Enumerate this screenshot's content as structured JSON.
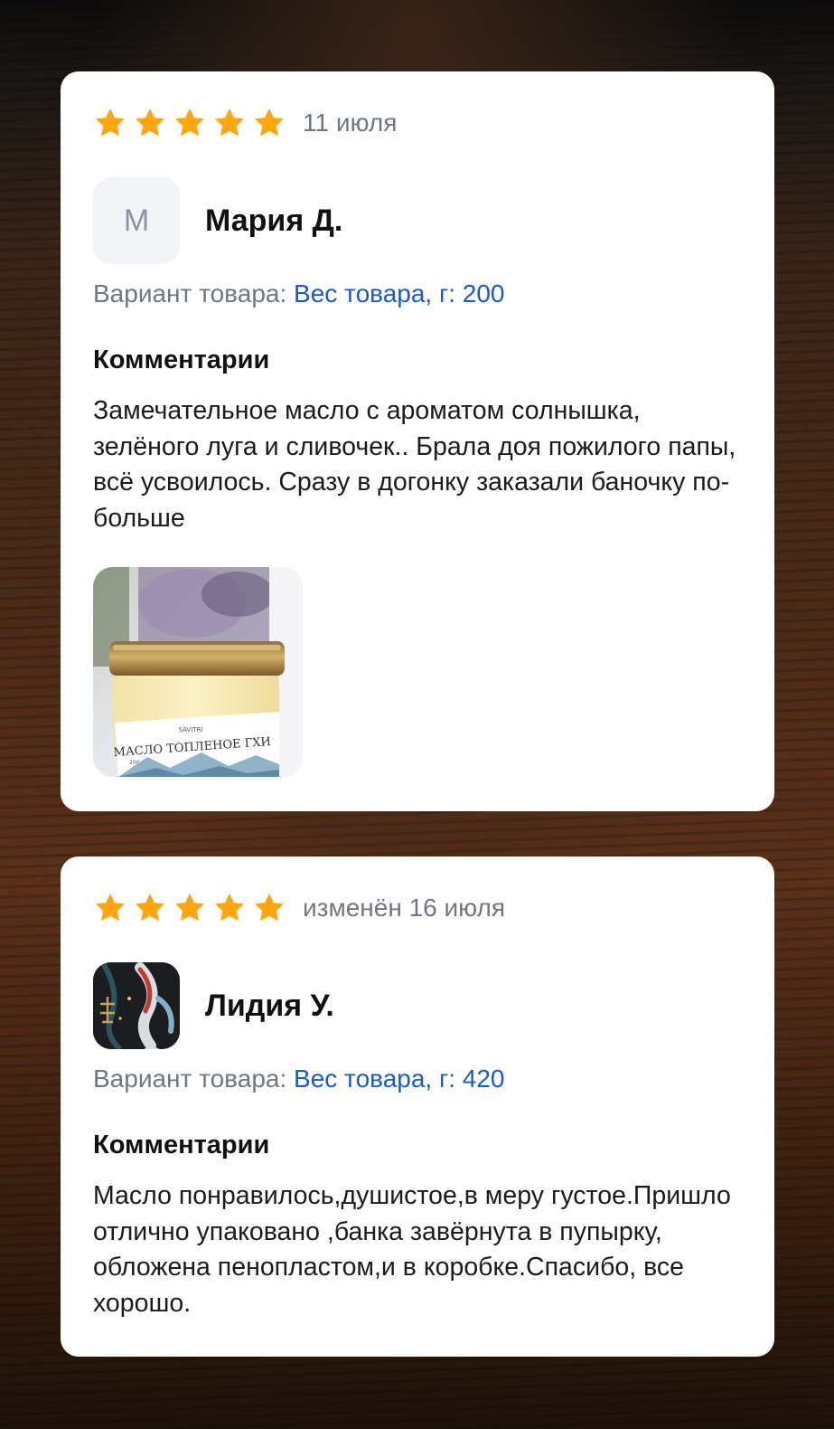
{
  "colors": {
    "star": "#FFA50F",
    "date_text": "#6F7780",
    "variant_link": "#1A5BC4",
    "card_bg": "#FFFFFF"
  },
  "reviews": [
    {
      "rating": 5,
      "date": "11 июля",
      "author": {
        "initial": "М",
        "name": "Мария Д."
      },
      "variant_label": "Вариант товара: ",
      "variant_value": "Вес товара, г: 200",
      "comments_title": "Комментарии",
      "comment": "Замечательное масло с ароматом солнышка, зелёного луга и сливочек.. Брала доя пожилого папы, всё усвоилось. Сразу в догонку заказали баночку по-больше",
      "photo": {
        "icon": "ghee-jar-photo",
        "brand": "SAVITRI",
        "label": "МАСЛО ТОПЛЕНОЕ ГХИ",
        "weight": "200 мл"
      }
    },
    {
      "rating": 5,
      "date": "изменён 16 июля",
      "author": {
        "name": "Лидия У.",
        "avatar_icon": "koi-fish-avatar-icon"
      },
      "variant_label": "Вариант товара: ",
      "variant_value": "Вес товара, г: 420",
      "comments_title": "Комментарии",
      "comment": "Масло понравилось,душистое,в меру густое.Пришло отлично упаковано ,банка завёрнута в пупырку, обложена пенопластом,и в коробке.Спасибо, все хорошо."
    }
  ]
}
